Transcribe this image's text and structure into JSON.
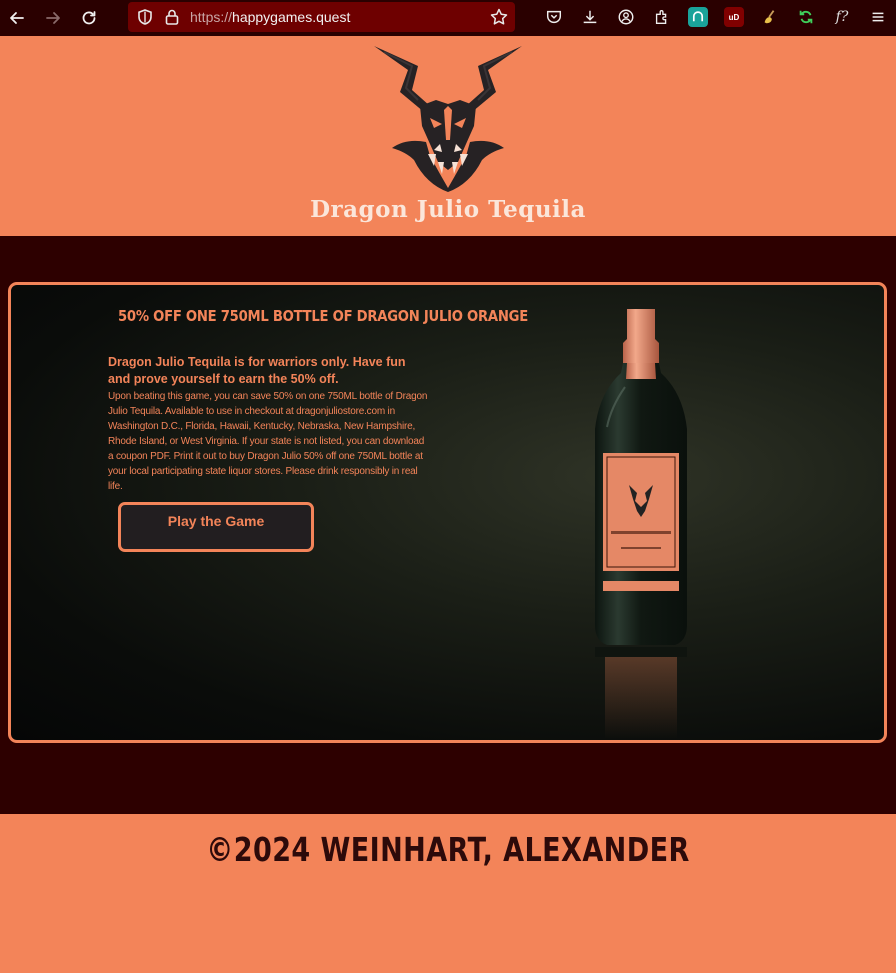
{
  "browser": {
    "url_protocol": "https://",
    "url_host": "happygames.quest",
    "extensions": [
      "pocket-icon",
      "download-icon",
      "account-icon",
      "extensions-icon",
      "shield-app-icon",
      "ublock-icon",
      "broom-icon",
      "sync-icon",
      "font-finder-icon",
      "menu-icon"
    ],
    "ublock_badge": "uD",
    "font_ext_label": "f?"
  },
  "header": {
    "brand": "Dragon Julio Tequila"
  },
  "promo": {
    "title": "50% OFF ONE 750ML BOTTLE OF DRAGON JULIO ORANGE",
    "lead": "Dragon Julio Tequila is for warriors only. Have fun and prove yourself to earn the 50% off.",
    "body": "Upon beating this game, you can save 50% on one 750ML bottle of Dragon Julio Tequila. Available to use in checkout at dragonjuliostore.com in Washington D.C., Florida, Hawaii, Kentucky, Nebraska, New Hampshire, Rhode Island, or West Virginia. If your state is not listed, you can download a coupon PDF. Print it out to buy Dragon Julio 50% off one 750ML bottle at your local participating state liquor stores. Please drink responsibly in real life.",
    "button": "Play the Game"
  },
  "footer": {
    "copyright": "©2024 WEINHART, ALEXANDER"
  },
  "colors": {
    "accent": "#f38459",
    "band": "#2d0000",
    "toolbar": "#2a0000",
    "urlbar": "#6e0000"
  }
}
